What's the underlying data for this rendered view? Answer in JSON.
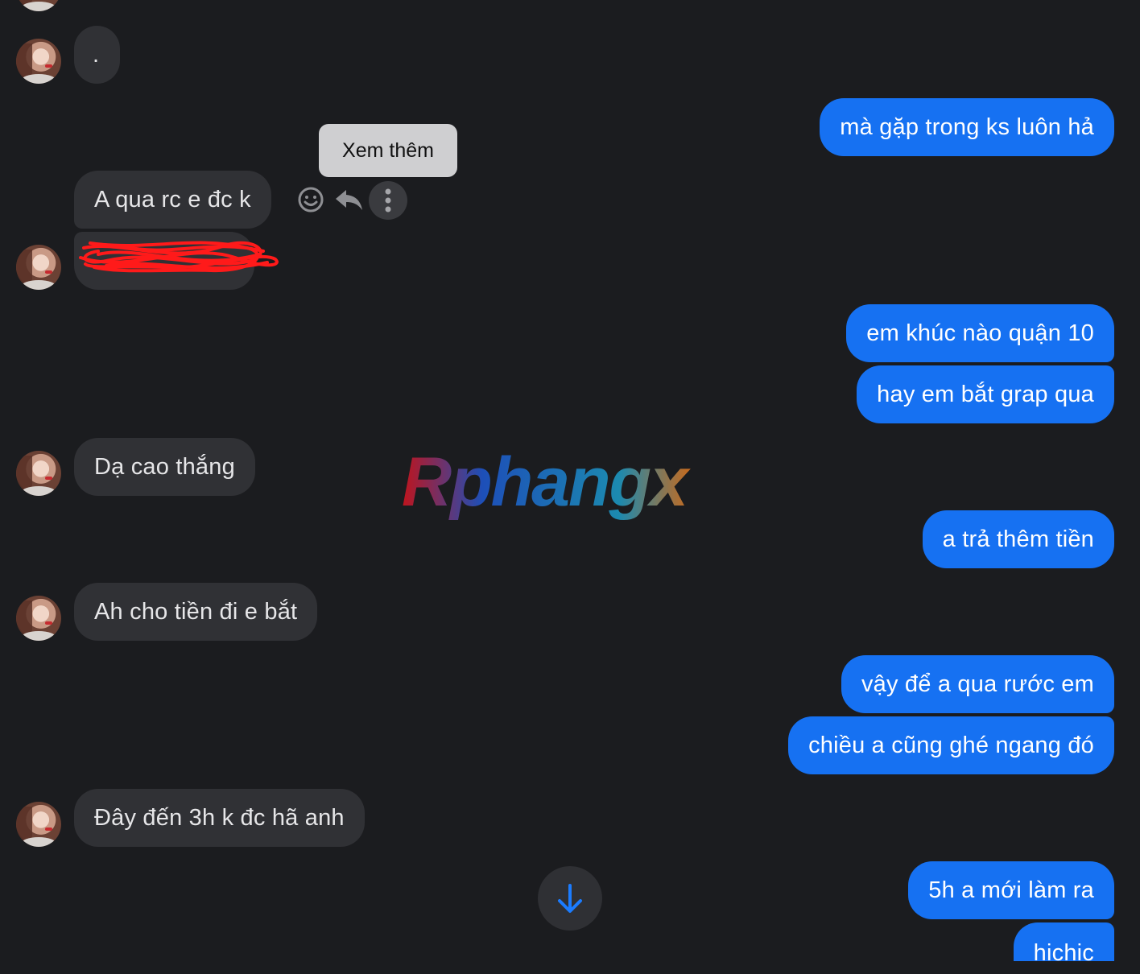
{
  "messages": {
    "dot": ".",
    "out1": "mà gặp trong ks luôn hả",
    "in1": "A qua rc e đc k",
    "out2": "em khúc nào quận 10",
    "out3": "hay em bắt grap qua",
    "in2": "Dạ cao thắng",
    "out4": "a trả thêm tiền",
    "in3": "Ah cho tiền đi e bắt",
    "out5": "vậy để a qua rước em",
    "out6": "chiều a cũng ghé ngang đó",
    "in4": "Đây đến 3h k đc hã anh",
    "out7": "5h a mới làm ra",
    "out8": "hichic"
  },
  "tooltip": {
    "label": "Xem thêm"
  },
  "watermark": {
    "text": "Rphangx"
  },
  "icons": {
    "react": "smiley-icon",
    "reply": "reply-arrow-icon",
    "more": "more-vertical-icon",
    "scroll": "arrow-down-icon"
  },
  "colors": {
    "background": "#1b1c1f",
    "incoming_bubble": "#303135",
    "outgoing_bubble": "#1671f2",
    "redaction": "#ff1a1a"
  }
}
